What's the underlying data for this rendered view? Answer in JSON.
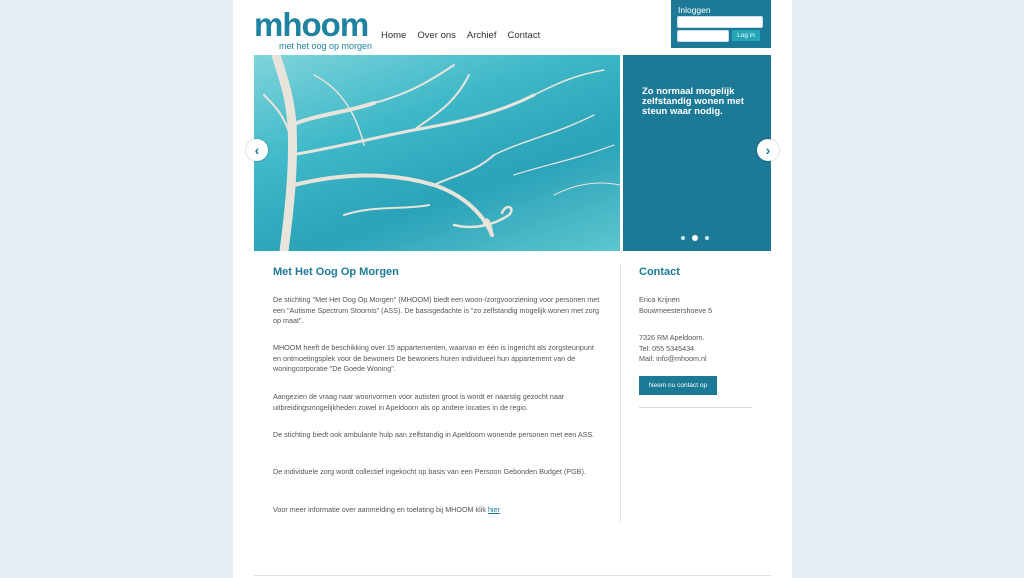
{
  "brand": {
    "logo_text": "mhoom",
    "tagline": "met het oog op morgen",
    "primary_color": "#1c7a96",
    "accent_color": "#23a7b8"
  },
  "nav": {
    "items": [
      {
        "label": "Home"
      },
      {
        "label": "Over ons"
      },
      {
        "label": "Archief"
      },
      {
        "label": "Contact"
      }
    ]
  },
  "login": {
    "title": "Inloggen",
    "button_label": "Log in"
  },
  "slider": {
    "text": "Zo normaal mogelijk zelfstandig wonen met steun waar nodig.",
    "prev_icon": "chevron-left-icon",
    "next_icon": "chevron-right-icon",
    "dots": 3,
    "active_dot": 2
  },
  "main": {
    "title": "Met Het Oog Op Morgen",
    "paragraphs": [
      "De stichting \"Met Het Oog Op Morgen\" (MHOOM) biedt een woon-/zorgvoorziening voor personen met een \"Autisme Spectrum Stoornis\" (ASS). De basisgedachte is \"zo zelfstandig mogelijk wonen met zorg op maat\".",
      "MHOOM heeft de beschikking over 15 appartementen, waarvan er één is ingericht als zorgsteunpunt en ontmoetingsplek voor de bewoners De bewoners huren individueel hun appartement van de woningcorporatie \"De Goede Woning\".",
      "Aangezien de vraag naar woonvormen voor autisten groot is wordt er naarstig gezocht naar uitbreidingsmogelijkheden zowel in Apeldoorn als op andere locaties in de regio.",
      "De stichting biedt ook ambulante hulp aan zelfstandig in Apeldoorn wonende personen met een ASS.",
      "De individuele zorg wordt collectief ingekocht op basis van een Persoon Gebonden Budget (PGB)."
    ],
    "last_paragraph": "Voor meer informatie over aanmelding en toelating bij MHOOM klik",
    "link_text": "hier"
  },
  "contact": {
    "title": "Contact",
    "name": "Erica Krijnen",
    "street": "Bouwmeestershoeve 5",
    "city": "7326 RM Apeldoorn.",
    "phone": "Tel: 055 5345434",
    "mail": "Mail: info@mhoom.nl",
    "button_label": "Neem nu contact op"
  }
}
